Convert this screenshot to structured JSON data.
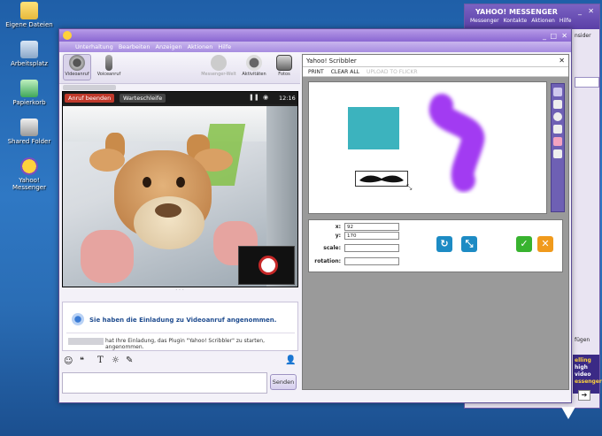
{
  "desktop": {
    "icons": [
      {
        "label": "Eigene Dateien"
      },
      {
        "label": "Arbeitsplatz"
      },
      {
        "label": "Papierkorb"
      },
      {
        "label": "Shared Folder"
      },
      {
        "label": "Yahoo! Messenger"
      }
    ]
  },
  "bg_window": {
    "brand": "YAHOO! MESSENGER",
    "menu": [
      "Messenger",
      "Kontakte",
      "Aktionen",
      "Hilfe"
    ],
    "frag_right": "nsider",
    "frag_bottom": "fügen",
    "ad_lines": [
      "elling",
      "high",
      "video",
      "essenger"
    ]
  },
  "main_window": {
    "menu": [
      "Unterhaltung",
      "Bearbeiten",
      "Anzeigen",
      "Aktionen",
      "Hilfe"
    ],
    "toolbar": [
      {
        "label": "Videoanruf"
      },
      {
        "label": "Voiceanruf"
      },
      {
        "label": "Messenger-Welt"
      },
      {
        "label": "Aktivitäten"
      },
      {
        "label": "Fotos"
      }
    ],
    "video": {
      "end_call": "Anruf beenden",
      "hold": "Warteschleife",
      "time": "12:16"
    },
    "invite_text": "Sie haben die Einladung zu Videoanruf angenommen.",
    "system_msg": "hat Ihre Einladung, das Plugin \"Yahoo! Scribbler\" zu starten, angenommen.",
    "send": "Senden"
  },
  "scribbler": {
    "title": "Yahoo! Scribbler",
    "menu": [
      "PRINT",
      "CLEAR ALL",
      "UPLOAD TO FLICKR"
    ],
    "fields": {
      "x_label": "x:",
      "x_value": "92",
      "y_label": "y:",
      "y_value": "170",
      "scale_label": "scale:",
      "scale_value": "",
      "rotation_label": "rotation:",
      "rotation_value": ""
    }
  },
  "colors": {
    "accent": "#7b5fc9",
    "end_call": "#c0392b",
    "teal_square": "#3cb3be",
    "purple_stroke": "#a23bf2",
    "ok": "#38b32f",
    "cancel": "#f09a1c"
  }
}
